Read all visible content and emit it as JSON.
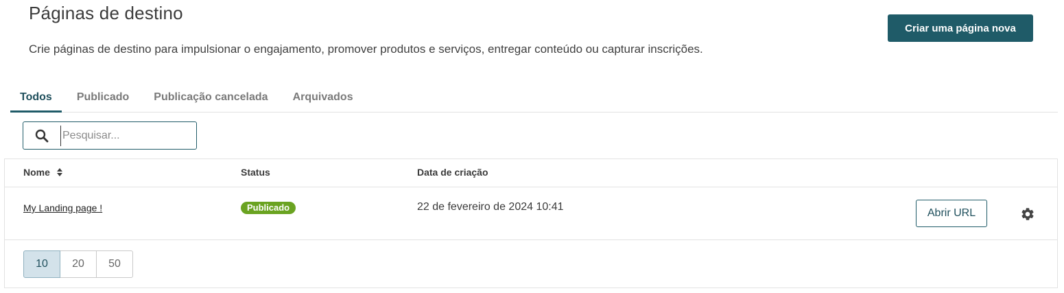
{
  "header": {
    "title": "Páginas de destino",
    "subtitle": "Crie páginas de destino para impulsionar o engajamento, promover produtos e serviços, entregar conteúdo ou capturar inscrições.",
    "create_label": "Criar uma página nova"
  },
  "tabs": [
    {
      "label": "Todos",
      "active": true
    },
    {
      "label": "Publicado"
    },
    {
      "label": "Publicação cancelada"
    },
    {
      "label": "Arquivados"
    }
  ],
  "search": {
    "placeholder": "Pesquisar...",
    "value": "",
    "icon": "search-icon"
  },
  "table": {
    "headers": {
      "name": "Nome",
      "status": "Status",
      "created": "Data de criação"
    },
    "rows": [
      {
        "name": "My Landing page !",
        "status": "Publicado",
        "created": "22 de fevereiro de 2024 10:41",
        "action_label": "Abrir URL",
        "settings_icon": "gear-icon"
      }
    ]
  },
  "pagination": {
    "sizes": [
      "10",
      "20",
      "50"
    ],
    "selected": "10"
  },
  "colors": {
    "primary": "#1f5b68",
    "status_published": "#6aa321",
    "pager_active": "#d3e2ea"
  }
}
